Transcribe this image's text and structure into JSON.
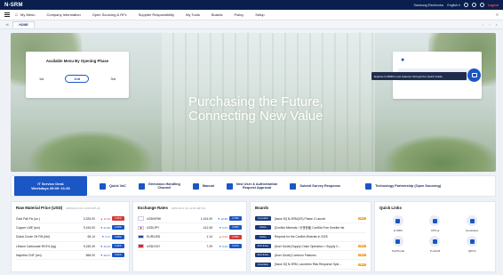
{
  "app": {
    "title": "N-SRM"
  },
  "topbar": {
    "company": "Samsung Electronics",
    "language": "English",
    "logout": "Logout"
  },
  "menu": {
    "items": [
      "My Menu",
      "Company Information",
      "Open Sourcing & RFx",
      "Supplier Responsibility",
      "My Tools",
      "Boards",
      "Policy",
      "Setup"
    ]
  },
  "tabs": {
    "home": "HOME"
  },
  "hero": {
    "headline_line1": "Purchasing the Future,",
    "headline_line2": "Connecting New Value",
    "phase_card": {
      "title": "Available Menu By Opening Phase",
      "options": [
        "1st",
        "2nd",
        "3rd"
      ],
      "selected": "2nd"
    },
    "welcome": "Welcome",
    "tip": "Explore N-SRM's new features through the Quick Guide."
  },
  "quickbar": {
    "service_desk_title": "IT Service Desk",
    "service_desk_hours": "Weekdays 09:00~21:30",
    "items": [
      {
        "line1": "Quick VoC",
        "line2": ""
      },
      {
        "line1": "Grievance-Handling",
        "line2": "Channel"
      },
      {
        "line1": "Manual",
        "line2": ""
      },
      {
        "line1": "New User & Authorization",
        "line2": "Request Approval"
      },
      {
        "line1": "Submit Survey Response",
        "line2": ""
      },
      {
        "line1": "Technology Partnership (Open Sourcing)",
        "line2": ""
      }
    ]
  },
  "raw_material": {
    "title": "Raw Material Price (USD)",
    "date": "2025-04-21 (for 14:00 GMT+9)",
    "rows": [
      {
        "name": "Gold Pall Fix (oz.)",
        "value": "3,333.00",
        "change": "▲ 11.20",
        "tag": "0.34%",
        "dir": "up"
      },
      {
        "name": "Copper LME (ton)",
        "value": "9,154.00",
        "change": "▼ 21.00",
        "tag": "0.23%",
        "dir": "dn"
      },
      {
        "name": "Dubai Crude Oil F/B (bbl)",
        "value": "68.14",
        "change": "▼ 2.17",
        "tag": "3.09%",
        "dir": "dn"
      },
      {
        "name": "Lithium Carbonate 99.5% (kg)",
        "value": "9,150.49",
        "change": "▼ 40.23",
        "tag": "0.44%",
        "dir": "dn"
      },
      {
        "name": "Naphtha CNF (ton)",
        "value": "566.00",
        "change": "▼ 30.07",
        "tag": "5.04%",
        "dir": "dn"
      }
    ]
  },
  "exchange": {
    "title": "Exchange Rates",
    "date": "2025-04-21 (for 14:00 GMT+9)",
    "rows": [
      {
        "code": "USD/KRW",
        "value": "1,424.00",
        "change": "▼ 10.90",
        "tag": "0.76%",
        "dir": "dn",
        "flag": "kr"
      },
      {
        "code": "USD/JPY",
        "value": "141.08",
        "change": "▼ 0.07",
        "tag": "0.05%",
        "dir": "dn",
        "flag": "jp"
      },
      {
        "code": "EUR/USD",
        "value": "1.14",
        "change": "▲ 0.00",
        "tag": "0.35%",
        "dir": "up",
        "flag": "eu"
      },
      {
        "code": "USD/CNY",
        "value": "7.29",
        "change": "▼ 0.02",
        "tag": "0.27%",
        "dir": "dn",
        "flag": "cn"
      }
    ]
  },
  "boards": {
    "title": "Boards",
    "rows": [
      {
        "badge": "Innovation",
        "text": "[Issue ID] N-SRM(OS) Phase 2 Launch",
        "new": "NEW"
      },
      {
        "badge": "Notice",
        "text": "[Conflict Minerals / 分쟁광물] Conflict-Free Smelter list",
        "new": ""
      },
      {
        "badge": "Notice",
        "text": "Request for the Conflict Minerals in 2025",
        "new": ""
      },
      {
        "badge": "Ref.Library",
        "text": "[User Guide] Supply Chain Operation > Supply C...",
        "new": "NEW"
      },
      {
        "badge": "Ref.Library",
        "text": "[User Guide] Common Features",
        "new": "NEW"
      },
      {
        "badge": "Innovation",
        "text": "[Issue ID] N-SRM, Launches Risk Response Syst...",
        "new": "NEW"
      }
    ]
  },
  "quick_links": {
    "title": "Quick Links",
    "items": [
      "E-SRM",
      "CPS.ai",
      "Goodwave",
      "TechPortal",
      "P-eSCM",
      "QDCS"
    ]
  },
  "colors": {
    "navy": "#0a1f4d",
    "accent": "#1a56c4",
    "up": "#d23a3a"
  }
}
